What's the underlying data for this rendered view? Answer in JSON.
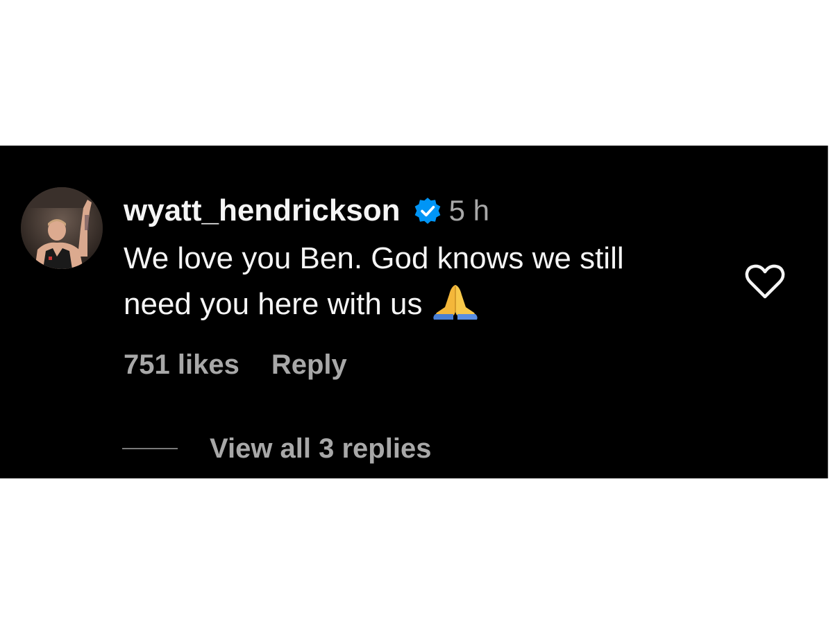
{
  "comment": {
    "username": "wyatt_hendrickson",
    "verified_icon": "verified-badge-icon",
    "timestamp": "5 h",
    "text_line_1": "We love you Ben. God knows we still",
    "text_line_2": "need you here with us",
    "emoji_icon": "folded-hands-emoji",
    "like_icon": "heart-outline-icon",
    "likes": "751 likes",
    "reply_label": "Reply",
    "view_replies_label": "View all 3 replies"
  },
  "colors": {
    "background": "#000000",
    "primary_text": "#f5f5f5",
    "secondary_text": "#a8a8a8",
    "verified_blue": "#0095f6"
  }
}
